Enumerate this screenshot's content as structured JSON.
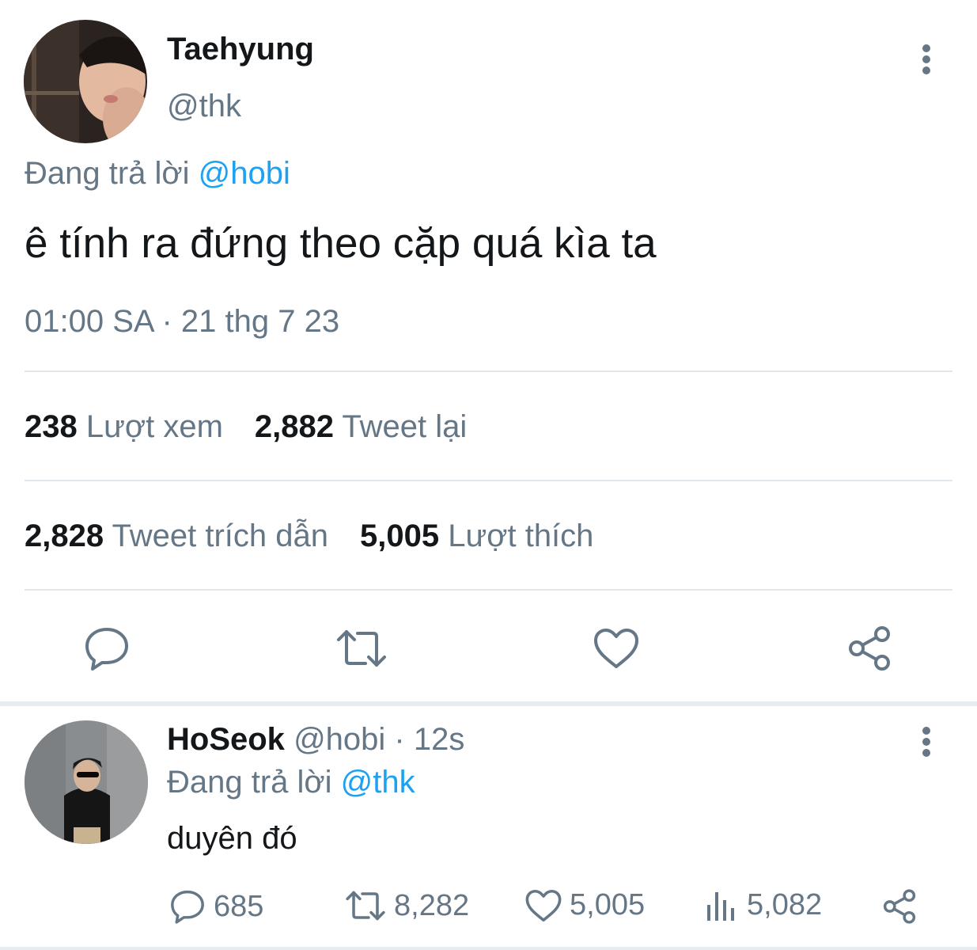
{
  "main_tweet": {
    "author_name": "Taehyung",
    "author_handle": "@thk",
    "reply_prefix": "Đang trả lời ",
    "reply_mention": "@hobi",
    "text": "ê tính ra đứng theo cặp quá kìa ta",
    "timestamp": "01:00 SA · 21 thg 7 23",
    "stats_row1": [
      {
        "num": "238",
        "label": "Lượt xem"
      },
      {
        "num": "2,882",
        "label": "Tweet lại"
      }
    ],
    "stats_row2": [
      {
        "num": "2,828",
        "label": "Tweet trích dẫn"
      },
      {
        "num": "5,005",
        "label": "Lượt thích"
      }
    ],
    "actions": [
      "reply-icon",
      "retweet-icon",
      "like-icon",
      "share-icon"
    ]
  },
  "reply_tweet": {
    "author_name": "HoSeok",
    "author_handle": "@hobi",
    "time": "· 12s",
    "reply_prefix": "Đang trả lời ",
    "reply_mention": "@thk",
    "text": "duyên đó",
    "counts": {
      "replies": "685",
      "retweets": "8,282",
      "likes": "5,005",
      "views": "5,082"
    }
  },
  "colors": {
    "text": "#14171a",
    "secondary": "#657786",
    "accent": "#1da1f2",
    "divider": "#e1e8ed"
  }
}
